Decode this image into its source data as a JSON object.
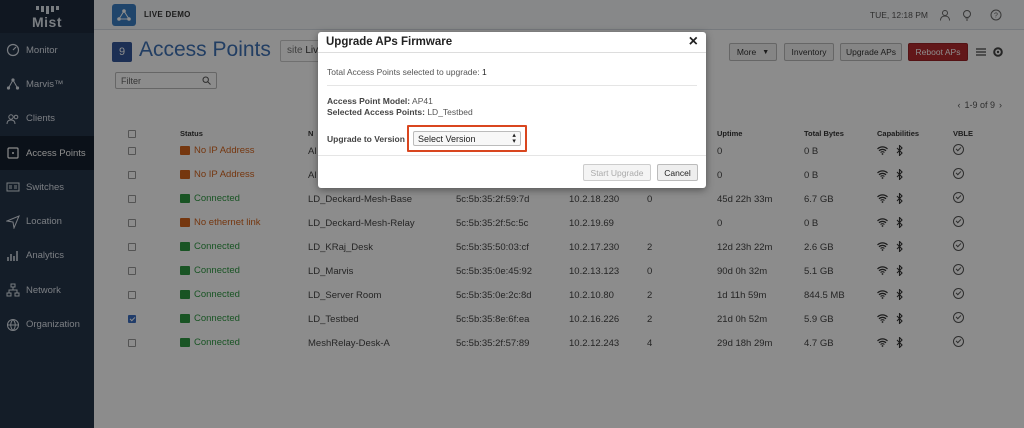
{
  "sidebar": {
    "logo_text": "Mist",
    "items": [
      {
        "label": "Monitor",
        "icon": "monitor-icon",
        "active": false
      },
      {
        "label": "Marvis™",
        "icon": "marvis-icon",
        "active": false
      },
      {
        "label": "Clients",
        "icon": "clients-icon",
        "active": false
      },
      {
        "label": "Access Points",
        "icon": "access-point-icon",
        "active": true
      },
      {
        "label": "Switches",
        "icon": "switches-icon",
        "active": false
      },
      {
        "label": "Location",
        "icon": "location-icon",
        "active": false
      },
      {
        "label": "Analytics",
        "icon": "analytics-icon",
        "active": false
      },
      {
        "label": "Network",
        "icon": "network-icon",
        "active": false
      },
      {
        "label": "Organization",
        "icon": "organization-icon",
        "active": false
      }
    ]
  },
  "topbar": {
    "org_name": "LIVE DEMO",
    "datetime": "TUE, 12:18 PM"
  },
  "header": {
    "count": "9",
    "title": "Access Points",
    "site_label": "site",
    "site_value": "Liv"
  },
  "toolbar": {
    "more": "More",
    "inventory": "Inventory",
    "upgrade_aps": "Upgrade APs",
    "reboot_aps": "Reboot APs"
  },
  "filter_placeholder": "Filter",
  "pager": {
    "range": "1-9 of 9"
  },
  "table": {
    "headers": {
      "status": "Status",
      "name": "N",
      "mac": "",
      "ip": "",
      "clients": "",
      "uptime": "Uptime",
      "bytes": "Total Bytes",
      "caps": "Capabilities",
      "vble": "VBLE"
    },
    "rows": [
      {
        "checked": false,
        "status": "No IP Address",
        "status_color": "orange",
        "name": "Al",
        "mac": "",
        "ip": "",
        "clients": "",
        "uptime": "0",
        "bytes": "0 B"
      },
      {
        "checked": false,
        "status": "No IP Address",
        "status_color": "orange",
        "name": "Al",
        "mac": "",
        "ip": "",
        "clients": "",
        "uptime": "0",
        "bytes": "0 B"
      },
      {
        "checked": false,
        "status": "Connected",
        "status_color": "green",
        "name": "LD_Deckard-Mesh-Base",
        "mac": "5c:5b:35:2f:59:7d",
        "ip": "10.2.18.230",
        "clients": "0",
        "uptime": "45d 22h 33m",
        "bytes": "6.7 GB"
      },
      {
        "checked": false,
        "status": "No ethernet link",
        "status_color": "orange",
        "name": "LD_Deckard-Mesh-Relay",
        "mac": "5c:5b:35:2f:5c:5c",
        "ip": "10.2.19.69",
        "clients": "",
        "uptime": "0",
        "bytes": "0 B"
      },
      {
        "checked": false,
        "status": "Connected",
        "status_color": "green",
        "name": "LD_KRaj_Desk",
        "mac": "5c:5b:35:50:03:cf",
        "ip": "10.2.17.230",
        "clients": "2",
        "uptime": "12d 23h 22m",
        "bytes": "2.6 GB"
      },
      {
        "checked": false,
        "status": "Connected",
        "status_color": "green",
        "name": "LD_Marvis",
        "mac": "5c:5b:35:0e:45:92",
        "ip": "10.2.13.123",
        "clients": "0",
        "uptime": "90d 0h 32m",
        "bytes": "5.1 GB"
      },
      {
        "checked": false,
        "status": "Connected",
        "status_color": "green",
        "name": "LD_Server Room",
        "mac": "5c:5b:35:0e:2c:8d",
        "ip": "10.2.10.80",
        "clients": "2",
        "uptime": "1d 11h 59m",
        "bytes": "844.5 MB"
      },
      {
        "checked": true,
        "status": "Connected",
        "status_color": "green",
        "name": "LD_Testbed",
        "mac": "5c:5b:35:8e:6f:ea",
        "ip": "10.2.16.226",
        "clients": "2",
        "uptime": "21d 0h 52m",
        "bytes": "5.9 GB"
      },
      {
        "checked": false,
        "status": "Connected",
        "status_color": "green",
        "name": "MeshRelay-Desk-A",
        "mac": "5c:5b:35:2f:57:89",
        "ip": "10.2.12.243",
        "clients": "4",
        "uptime": "29d 18h 29m",
        "bytes": "4.7 GB"
      }
    ]
  },
  "modal": {
    "title": "Upgrade APs Firmware",
    "selected_label": "Total Access Points selected to upgrade:",
    "selected_count": "1",
    "model_label": "Access Point Model:",
    "model_value": "AP41",
    "selected_ap_label": "Selected Access Points:",
    "selected_ap_value": "LD_Testbed",
    "version_label": "Upgrade to Version",
    "version_value": "Select Version",
    "start_button": "Start Upgrade",
    "cancel_button": "Cancel"
  },
  "colors": {
    "sidebar": "#26354a",
    "accent": "#3f72b5",
    "connected": "#2f9a43",
    "warning": "#d6641d",
    "danger": "#b22a2e",
    "highlight": "#d9461f"
  }
}
